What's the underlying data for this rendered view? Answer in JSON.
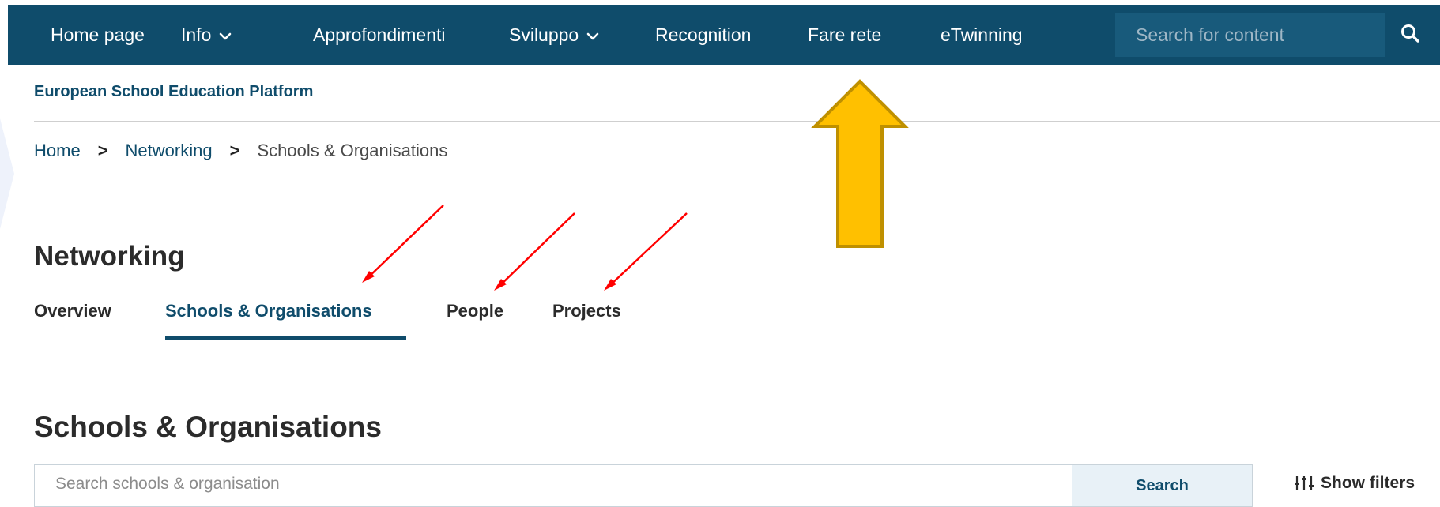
{
  "topnav": {
    "items": [
      {
        "label": "Home page",
        "has_dropdown": false
      },
      {
        "label": "Info",
        "has_dropdown": true
      },
      {
        "label": "Approfondimenti",
        "has_dropdown": false
      },
      {
        "label": "Sviluppo",
        "has_dropdown": true
      },
      {
        "label": "Recognition",
        "has_dropdown": false
      },
      {
        "label": "Fare rete",
        "has_dropdown": false
      },
      {
        "label": "eTwinning",
        "has_dropdown": false
      }
    ],
    "search_placeholder": "Search for content",
    "search_icon": "search-icon"
  },
  "site_title": "European School Education Platform",
  "breadcrumb": {
    "items": [
      "Home",
      "Networking",
      "Schools & Organisations"
    ],
    "separator": ">"
  },
  "page_title": "Networking",
  "tabs": {
    "items": [
      "Overview",
      "Schools & Organisations",
      "People",
      "Projects"
    ],
    "active": "Schools & Organisations"
  },
  "section_title": "Schools & Organisations",
  "org_search": {
    "placeholder": "Search schools & organisation",
    "button_label": "Search"
  },
  "filters": {
    "label": "Show filters",
    "icon": "sliders-icon"
  },
  "colors": {
    "nav_background": "#0f4c6b",
    "accent": "#0f4c6b",
    "highlight_arrow": "#ffc000",
    "annotation_arrow": "#ff0000"
  }
}
